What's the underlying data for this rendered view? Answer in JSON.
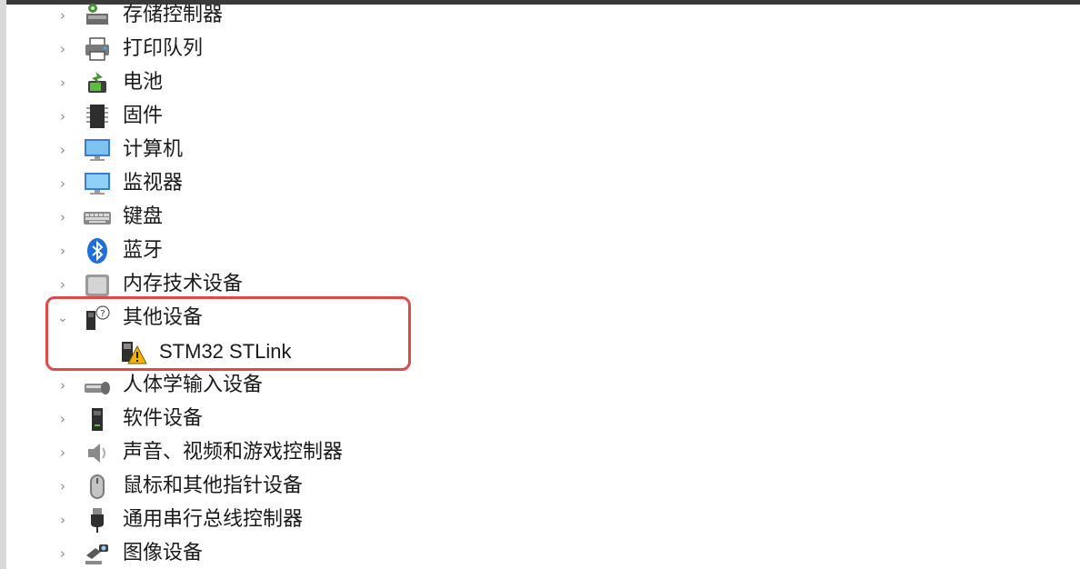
{
  "tree": {
    "items": [
      {
        "label": "存储控制器",
        "expanded": false,
        "icon": "storage-controller-icon"
      },
      {
        "label": "打印队列",
        "expanded": false,
        "icon": "printer-icon"
      },
      {
        "label": "电池",
        "expanded": false,
        "icon": "battery-icon"
      },
      {
        "label": "固件",
        "expanded": false,
        "icon": "firmware-icon"
      },
      {
        "label": "计算机",
        "expanded": false,
        "icon": "computer-icon"
      },
      {
        "label": "监视器",
        "expanded": false,
        "icon": "monitor-icon"
      },
      {
        "label": "键盘",
        "expanded": false,
        "icon": "keyboard-icon"
      },
      {
        "label": "蓝牙",
        "expanded": false,
        "icon": "bluetooth-icon"
      },
      {
        "label": "内存技术设备",
        "expanded": false,
        "icon": "memory-device-icon"
      },
      {
        "label": "其他设备",
        "expanded": true,
        "icon": "unknown-device-icon",
        "children": [
          {
            "label": "STM32 STLink",
            "icon": "warning-device-icon"
          }
        ]
      },
      {
        "label": "人体学输入设备",
        "expanded": false,
        "icon": "hid-icon"
      },
      {
        "label": "软件设备",
        "expanded": false,
        "icon": "software-device-icon"
      },
      {
        "label": "声音、视频和游戏控制器",
        "expanded": false,
        "icon": "speaker-icon"
      },
      {
        "label": "鼠标和其他指针设备",
        "expanded": false,
        "icon": "mouse-icon"
      },
      {
        "label": "通用串行总线控制器",
        "expanded": false,
        "icon": "usb-icon"
      },
      {
        "label": "图像设备",
        "expanded": false,
        "icon": "camera-icon"
      }
    ]
  },
  "colors": {
    "highlight_border": "#e04a4a",
    "chevron": "#8a8a8a",
    "text": "#1a1a1a",
    "warning": "#f2b400"
  }
}
